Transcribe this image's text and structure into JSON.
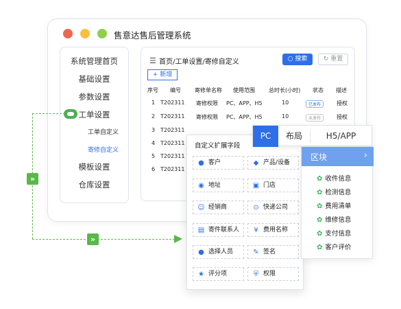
{
  "window": {
    "title": "售意达售后管理系统"
  },
  "sidebar": {
    "items": [
      "系统管理首页",
      "基础设置",
      "参数设置",
      "工单设置"
    ],
    "subitems": [
      "工单自定义",
      "寄修自定义"
    ],
    "items_after": [
      "模板设置",
      "仓库设置"
    ]
  },
  "content": {
    "breadcrumb": "首页/工单设置/寄修自定义",
    "search_label": "搜索",
    "reset_label": "重置",
    "add_label": "+ 新增",
    "columns": [
      "序号",
      "编号",
      "寄修单名称",
      "使用范围",
      "总时长(小时)",
      "状态",
      "描述"
    ],
    "rows": [
      [
        "1",
        "T202311",
        "寄修权限",
        "PC、APP、H5",
        "10",
        "已发布",
        "授权"
      ],
      [
        "2",
        "T202311",
        "寄修权限",
        "PC、APP、H5",
        "10",
        "未发布",
        "授权"
      ],
      [
        "3",
        "T202311",
        "",
        "",
        "",
        "",
        ""
      ],
      [
        "4",
        "T202311",
        "",
        "",
        "",
        "",
        ""
      ],
      [
        "5",
        "T202311",
        "",
        "",
        "",
        "",
        ""
      ],
      [
        "6",
        "T202311",
        "",
        "",
        "",
        "",
        ""
      ]
    ]
  },
  "tabs": [
    "PC",
    "布局",
    "H5/APP"
  ],
  "fields": {
    "title": "自定义扩展字段",
    "items": [
      {
        "label": "客户",
        "icon": "person-icon"
      },
      {
        "label": "产品/设备",
        "icon": "cube-icon"
      },
      {
        "label": "地址",
        "icon": "location-pin-icon"
      },
      {
        "label": "门店",
        "icon": "store-icon"
      },
      {
        "label": "经销商",
        "icon": "people-icon"
      },
      {
        "label": "快递公司",
        "icon": "delivery-icon"
      },
      {
        "label": "寄件联系人",
        "icon": "contact-icon"
      },
      {
        "label": "费用名称",
        "icon": "yen-icon"
      },
      {
        "label": "选择人员",
        "icon": "person-select-icon"
      },
      {
        "label": "签名",
        "icon": "signature-icon"
      },
      {
        "label": "评分项",
        "icon": "star-icon"
      },
      {
        "label": "权限",
        "icon": "shield-icon"
      }
    ]
  },
  "block": {
    "title": "区块",
    "items": [
      "收件信息",
      "检测信息",
      "费用清单",
      "维修信息",
      "支付信息",
      "客户评价"
    ]
  },
  "colors": {
    "accent": "#2e6fe8",
    "connector": "#58b848",
    "block_header": "#6fa1ee"
  }
}
